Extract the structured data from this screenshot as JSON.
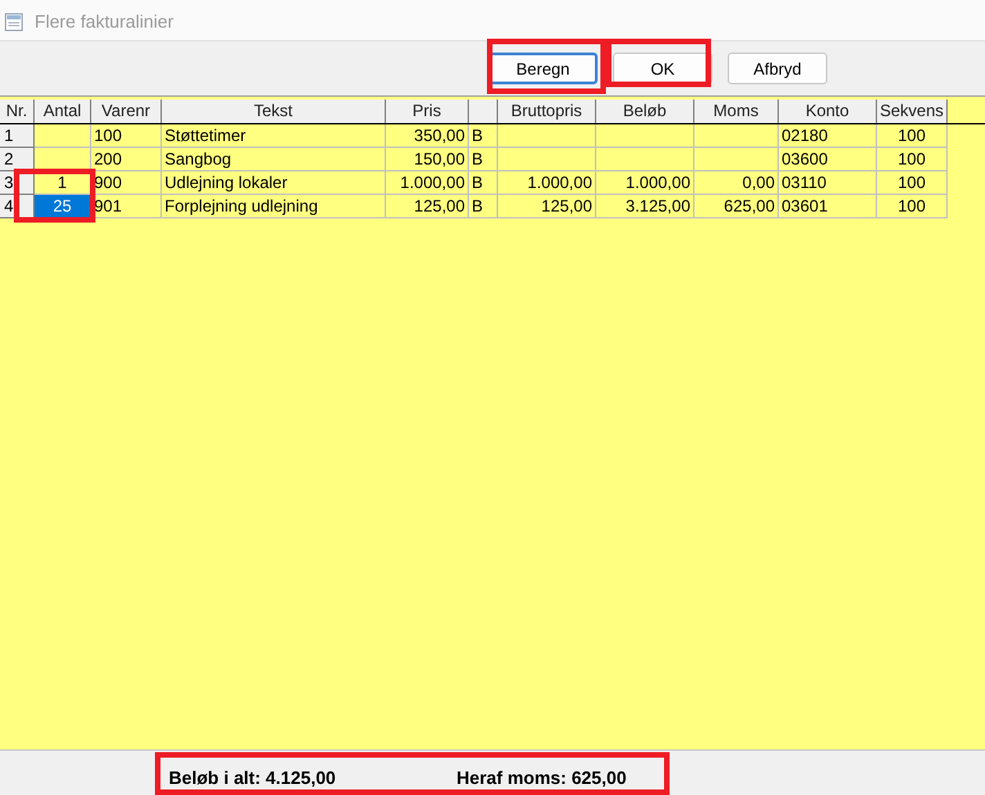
{
  "window": {
    "title": "Flere fakturalinier"
  },
  "buttons": [
    {
      "label": "Beregn",
      "focused": true
    },
    {
      "label": "OK",
      "focused": false
    },
    {
      "label": "Afbryd",
      "focused": false
    }
  ],
  "table": {
    "columns": [
      "Nr.",
      "Antal",
      "Varenr",
      "Tekst",
      "Pris",
      "",
      "Bruttopris",
      "Beløb",
      "Moms",
      "Konto",
      "Sekvens"
    ],
    "rows": [
      {
        "cells": [
          "1",
          "",
          "100",
          "Støttetimer",
          "350,00",
          "B",
          "",
          "",
          "",
          "02180",
          "100"
        ],
        "antal_selected": false
      },
      {
        "cells": [
          "2",
          "",
          "200",
          "Sangbog",
          "150,00",
          "B",
          "",
          "",
          "",
          "03600",
          "100"
        ],
        "antal_selected": false
      },
      {
        "cells": [
          "3",
          "1",
          "900",
          "Udlejning lokaler",
          "1.000,00",
          "B",
          "1.000,00",
          "1.000,00",
          "0,00",
          "03110",
          "100"
        ],
        "antal_selected": false
      },
      {
        "cells": [
          "4",
          "25",
          "901",
          "Forplejning udlejning",
          "125,00",
          "B",
          "125,00",
          "3.125,00",
          "625,00",
          "03601",
          "100"
        ],
        "antal_selected": true
      }
    ]
  },
  "status_bar": {
    "total": "Beløb i alt: 4.125,00",
    "vat": "Heraf moms: 625,00"
  },
  "annotations": [
    {
      "kind": "calc"
    },
    {
      "kind": "ok"
    },
    {
      "kind": "quantity"
    },
    {
      "kind": "totals"
    }
  ]
}
